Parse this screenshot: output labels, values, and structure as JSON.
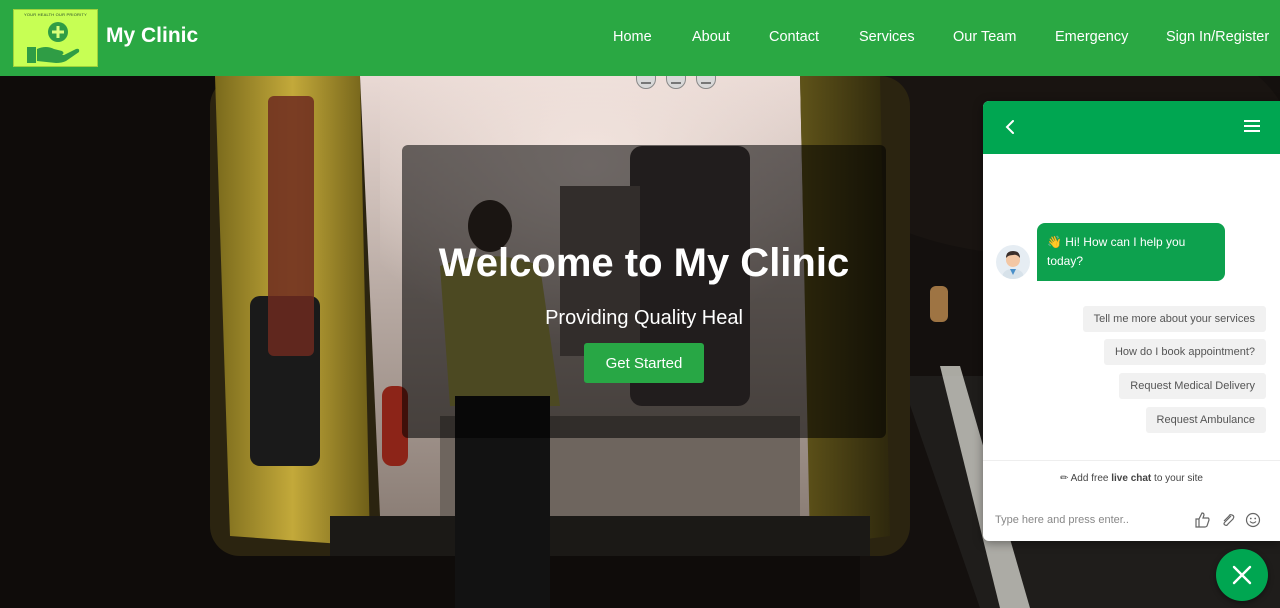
{
  "nav": {
    "logo_tagline": "YOUR HEALTH OUR PRIORITY",
    "brand": "My Clinic",
    "links": [
      "Home",
      "About",
      "Contact",
      "Services",
      "Our Team",
      "Emergency",
      "Sign In/Register"
    ]
  },
  "hero": {
    "title": "Welcome to My Clinic",
    "subtitle": "Providing Quality Heal",
    "cta": "Get Started"
  },
  "chat": {
    "greeting": "👋 Hi! How can I help you today?",
    "quick_replies": [
      "Tell me more about your services",
      "How do I book appointment?",
      "Request Medical Delivery",
      "Request Ambulance"
    ],
    "promo_prefix": "Add free ",
    "promo_bold": "live chat",
    "promo_suffix": " to your site",
    "input_placeholder": "Type here and press enter.."
  },
  "colors": {
    "nav_green": "#2aa843",
    "chat_green": "#00a651",
    "logo_bg": "#c7ff54"
  }
}
